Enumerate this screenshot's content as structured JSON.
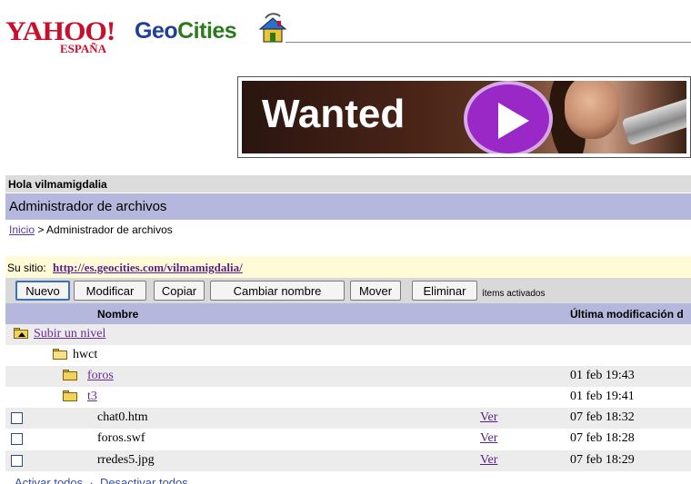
{
  "header": {
    "yahoo_logo": "YAHOO!",
    "espana": "ESPAÑA",
    "geo": "Geo",
    "cities": "Cities"
  },
  "banner": {
    "text": "Wanted",
    "colors": {
      "play": "#9a28c7"
    }
  },
  "greeting": "Hola vilmamigdalia",
  "page_title": "Administrador de archivos",
  "breadcrumb": {
    "home": "Inicio",
    "separator": ">",
    "current": "Administrador de archivos"
  },
  "site": {
    "label": "Su sitio:",
    "url": "http://es.geocities.com/vilmamigdalia/"
  },
  "toolbar": {
    "buttons": [
      "Nuevo",
      "Modificar",
      "Copiar",
      "Cambiar nombre",
      "Mover",
      "Eliminar"
    ],
    "note": "ítems activados"
  },
  "table": {
    "headers": {
      "name": "Nombre",
      "modified": "Última modificación d"
    },
    "up_level": "Subir un nivel",
    "current_folder": "hwct",
    "rows": [
      {
        "name": "foros",
        "type": "folder",
        "view": "",
        "date": "01 feb 19:43"
      },
      {
        "name": "t3",
        "type": "folder",
        "view": "",
        "date": "01 feb 19:41"
      },
      {
        "name": "chat0.htm",
        "type": "file",
        "view": "Ver",
        "date": "07 feb 18:32"
      },
      {
        "name": "foros.swf",
        "type": "file",
        "view": "Ver",
        "date": "07 feb 18:28"
      },
      {
        "name": "rredes5.jpg",
        "type": "file",
        "view": "Ver",
        "date": "07 feb 18:29"
      }
    ]
  },
  "footer": {
    "activate_all": "Activar todos",
    "deactivate_all": "Desactivar todos"
  },
  "colors": {
    "yahoo_red": "#c8102e",
    "geo_blue": "#1f3f99",
    "cities_green": "#2d7a1e",
    "title_bar": "#b5b8dc",
    "greet_bar": "#dcdcdc",
    "site_bar": "#fffbd6"
  }
}
